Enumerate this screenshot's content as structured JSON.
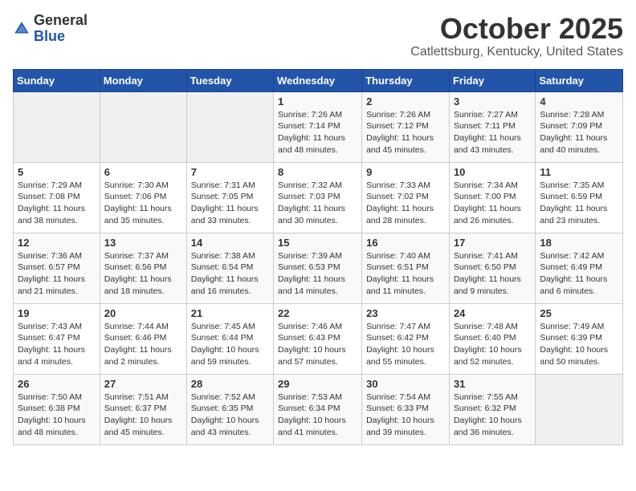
{
  "logo": {
    "text_general": "General",
    "text_blue": "Blue"
  },
  "header": {
    "month": "October 2025",
    "location": "Catlettsburg, Kentucky, United States"
  },
  "days_of_week": [
    "Sunday",
    "Monday",
    "Tuesday",
    "Wednesday",
    "Thursday",
    "Friday",
    "Saturday"
  ],
  "weeks": [
    [
      {
        "day": "",
        "info": ""
      },
      {
        "day": "",
        "info": ""
      },
      {
        "day": "",
        "info": ""
      },
      {
        "day": "1",
        "info": "Sunrise: 7:26 AM\nSunset: 7:14 PM\nDaylight: 11 hours and 48 minutes."
      },
      {
        "day": "2",
        "info": "Sunrise: 7:26 AM\nSunset: 7:12 PM\nDaylight: 11 hours and 45 minutes."
      },
      {
        "day": "3",
        "info": "Sunrise: 7:27 AM\nSunset: 7:11 PM\nDaylight: 11 hours and 43 minutes."
      },
      {
        "day": "4",
        "info": "Sunrise: 7:28 AM\nSunset: 7:09 PM\nDaylight: 11 hours and 40 minutes."
      }
    ],
    [
      {
        "day": "5",
        "info": "Sunrise: 7:29 AM\nSunset: 7:08 PM\nDaylight: 11 hours and 38 minutes."
      },
      {
        "day": "6",
        "info": "Sunrise: 7:30 AM\nSunset: 7:06 PM\nDaylight: 11 hours and 35 minutes."
      },
      {
        "day": "7",
        "info": "Sunrise: 7:31 AM\nSunset: 7:05 PM\nDaylight: 11 hours and 33 minutes."
      },
      {
        "day": "8",
        "info": "Sunrise: 7:32 AM\nSunset: 7:03 PM\nDaylight: 11 hours and 30 minutes."
      },
      {
        "day": "9",
        "info": "Sunrise: 7:33 AM\nSunset: 7:02 PM\nDaylight: 11 hours and 28 minutes."
      },
      {
        "day": "10",
        "info": "Sunrise: 7:34 AM\nSunset: 7:00 PM\nDaylight: 11 hours and 26 minutes."
      },
      {
        "day": "11",
        "info": "Sunrise: 7:35 AM\nSunset: 6:59 PM\nDaylight: 11 hours and 23 minutes."
      }
    ],
    [
      {
        "day": "12",
        "info": "Sunrise: 7:36 AM\nSunset: 6:57 PM\nDaylight: 11 hours and 21 minutes."
      },
      {
        "day": "13",
        "info": "Sunrise: 7:37 AM\nSunset: 6:56 PM\nDaylight: 11 hours and 18 minutes."
      },
      {
        "day": "14",
        "info": "Sunrise: 7:38 AM\nSunset: 6:54 PM\nDaylight: 11 hours and 16 minutes."
      },
      {
        "day": "15",
        "info": "Sunrise: 7:39 AM\nSunset: 6:53 PM\nDaylight: 11 hours and 14 minutes."
      },
      {
        "day": "16",
        "info": "Sunrise: 7:40 AM\nSunset: 6:51 PM\nDaylight: 11 hours and 11 minutes."
      },
      {
        "day": "17",
        "info": "Sunrise: 7:41 AM\nSunset: 6:50 PM\nDaylight: 11 hours and 9 minutes."
      },
      {
        "day": "18",
        "info": "Sunrise: 7:42 AM\nSunset: 6:49 PM\nDaylight: 11 hours and 6 minutes."
      }
    ],
    [
      {
        "day": "19",
        "info": "Sunrise: 7:43 AM\nSunset: 6:47 PM\nDaylight: 11 hours and 4 minutes."
      },
      {
        "day": "20",
        "info": "Sunrise: 7:44 AM\nSunset: 6:46 PM\nDaylight: 11 hours and 2 minutes."
      },
      {
        "day": "21",
        "info": "Sunrise: 7:45 AM\nSunset: 6:44 PM\nDaylight: 10 hours and 59 minutes."
      },
      {
        "day": "22",
        "info": "Sunrise: 7:46 AM\nSunset: 6:43 PM\nDaylight: 10 hours and 57 minutes."
      },
      {
        "day": "23",
        "info": "Sunrise: 7:47 AM\nSunset: 6:42 PM\nDaylight: 10 hours and 55 minutes."
      },
      {
        "day": "24",
        "info": "Sunrise: 7:48 AM\nSunset: 6:40 PM\nDaylight: 10 hours and 52 minutes."
      },
      {
        "day": "25",
        "info": "Sunrise: 7:49 AM\nSunset: 6:39 PM\nDaylight: 10 hours and 50 minutes."
      }
    ],
    [
      {
        "day": "26",
        "info": "Sunrise: 7:50 AM\nSunset: 6:38 PM\nDaylight: 10 hours and 48 minutes."
      },
      {
        "day": "27",
        "info": "Sunrise: 7:51 AM\nSunset: 6:37 PM\nDaylight: 10 hours and 45 minutes."
      },
      {
        "day": "28",
        "info": "Sunrise: 7:52 AM\nSunset: 6:35 PM\nDaylight: 10 hours and 43 minutes."
      },
      {
        "day": "29",
        "info": "Sunrise: 7:53 AM\nSunset: 6:34 PM\nDaylight: 10 hours and 41 minutes."
      },
      {
        "day": "30",
        "info": "Sunrise: 7:54 AM\nSunset: 6:33 PM\nDaylight: 10 hours and 39 minutes."
      },
      {
        "day": "31",
        "info": "Sunrise: 7:55 AM\nSunset: 6:32 PM\nDaylight: 10 hours and 36 minutes."
      },
      {
        "day": "",
        "info": ""
      }
    ]
  ]
}
